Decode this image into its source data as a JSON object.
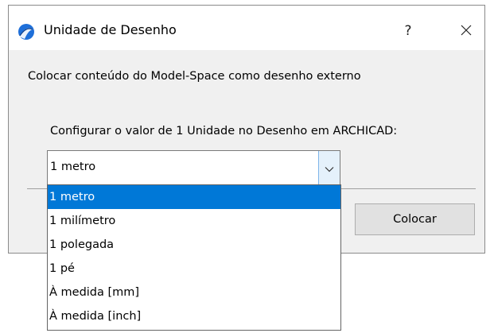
{
  "window": {
    "title": "Unidade de Desenho",
    "help_label": "?"
  },
  "description": "Colocar conteúdo do Model-Space como desenho externo",
  "config_label": "Configurar o valor de 1 Unidade no Desenho em ARCHICAD:",
  "unit_select": {
    "value": "1 metro",
    "expanded": true,
    "options": [
      "1 metro",
      "1 milímetro",
      "1 polegada",
      "1 pé",
      "À medida [mm]",
      "À medida [inch]"
    ],
    "highlighted_index": 0
  },
  "buttons": {
    "place_label": "Colocar"
  },
  "colors": {
    "selection": "#0078d7",
    "dialog_bg": "#f0f0f0",
    "icon_blue": "#1e6fd9"
  },
  "icons": {
    "app": "archicad-app-icon",
    "close": "close-icon",
    "dropdown": "chevron-down-icon"
  }
}
